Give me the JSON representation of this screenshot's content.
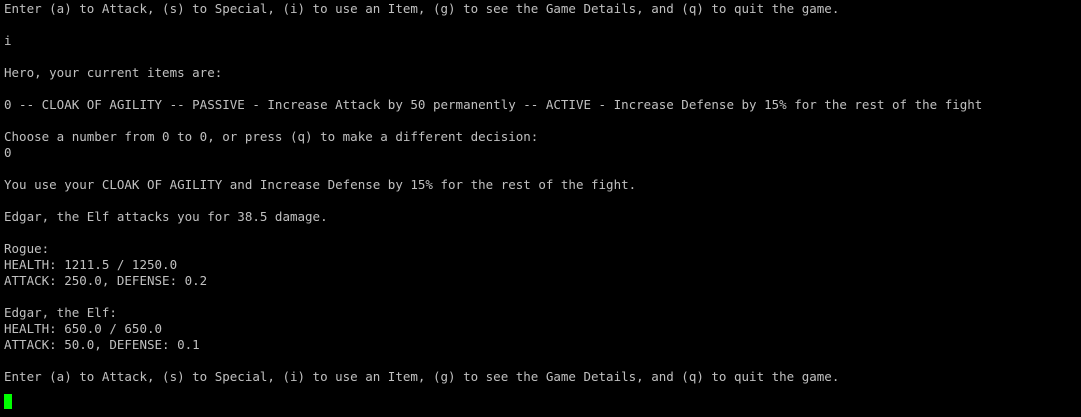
{
  "terminal": {
    "colors": {
      "background": "#000000",
      "text": "#c0c0c0",
      "cursor": "#00ff00"
    },
    "lines": [
      "Enter (a) to Attack, (s) to Special, (i) to use an Item, (g) to see the Game Details, and (q) to quit the game.",
      "",
      "i",
      "",
      "Hero, your current items are:",
      "",
      "0 -- CLOAK OF AGILITY -- PASSIVE - Increase Attack by 50 permanently -- ACTIVE - Increase Defense by 15% for the rest of the fight",
      "",
      "Choose a number from 0 to 0, or press (q) to make a different decision:",
      "0",
      "",
      "You use your CLOAK OF AGILITY and Increase Defense by 15% for the rest of the fight.",
      "",
      "Edgar, the Elf attacks you for 38.5 damage.",
      "",
      "Rogue:",
      "HEALTH: 1211.5 / 1250.0",
      "ATTACK: 250.0, DEFENSE: 0.2",
      "",
      "Edgar, the Elf:",
      "HEALTH: 650.0 / 650.0",
      "ATTACK: 50.0, DEFENSE: 0.1",
      "",
      "Enter (a) to Attack, (s) to Special, (i) to use an Item, (g) to see the Game Details, and (q) to quit the game."
    ]
  }
}
